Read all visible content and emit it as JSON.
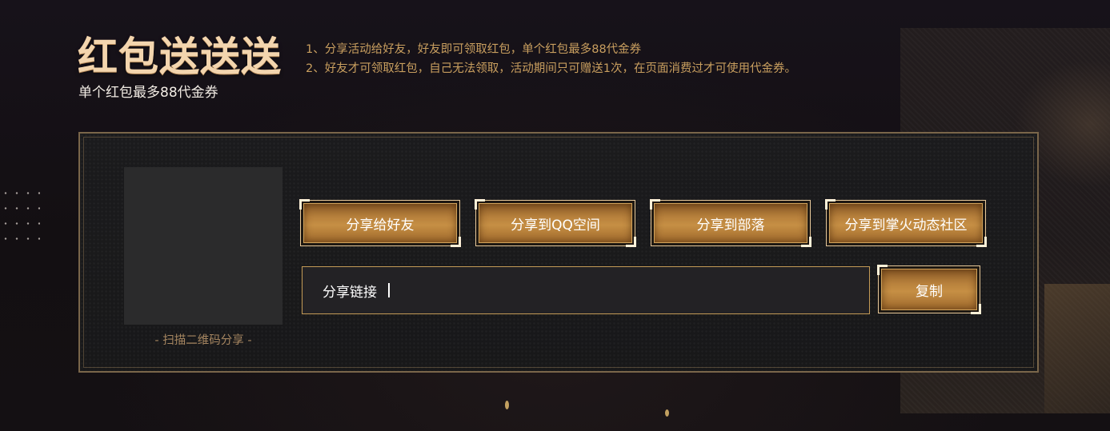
{
  "header": {
    "title": "红包送送送",
    "subtitle": "单个红包最多88代金券"
  },
  "rules": [
    "1、分享活动给好友，好友即可领取红包，单个红包最多88代金券",
    "2、好友才可领取红包，自己无法领取，活动期间只可赠送1次，在页面消费过才可使用代金券。"
  ],
  "qr": {
    "caption": "- 扫描二维码分享 -"
  },
  "share_buttons": [
    {
      "label": "分享给好友"
    },
    {
      "label": "分享到QQ空间"
    },
    {
      "label": "分享到部落"
    },
    {
      "label": "分享到掌火动态社区"
    }
  ],
  "link": {
    "label": "分享链接"
  },
  "copy_button": {
    "label": "复制"
  },
  "colors": {
    "accent_gold": "#c99f5f",
    "title_gold": "#f3d5ae",
    "background": "#151114"
  }
}
